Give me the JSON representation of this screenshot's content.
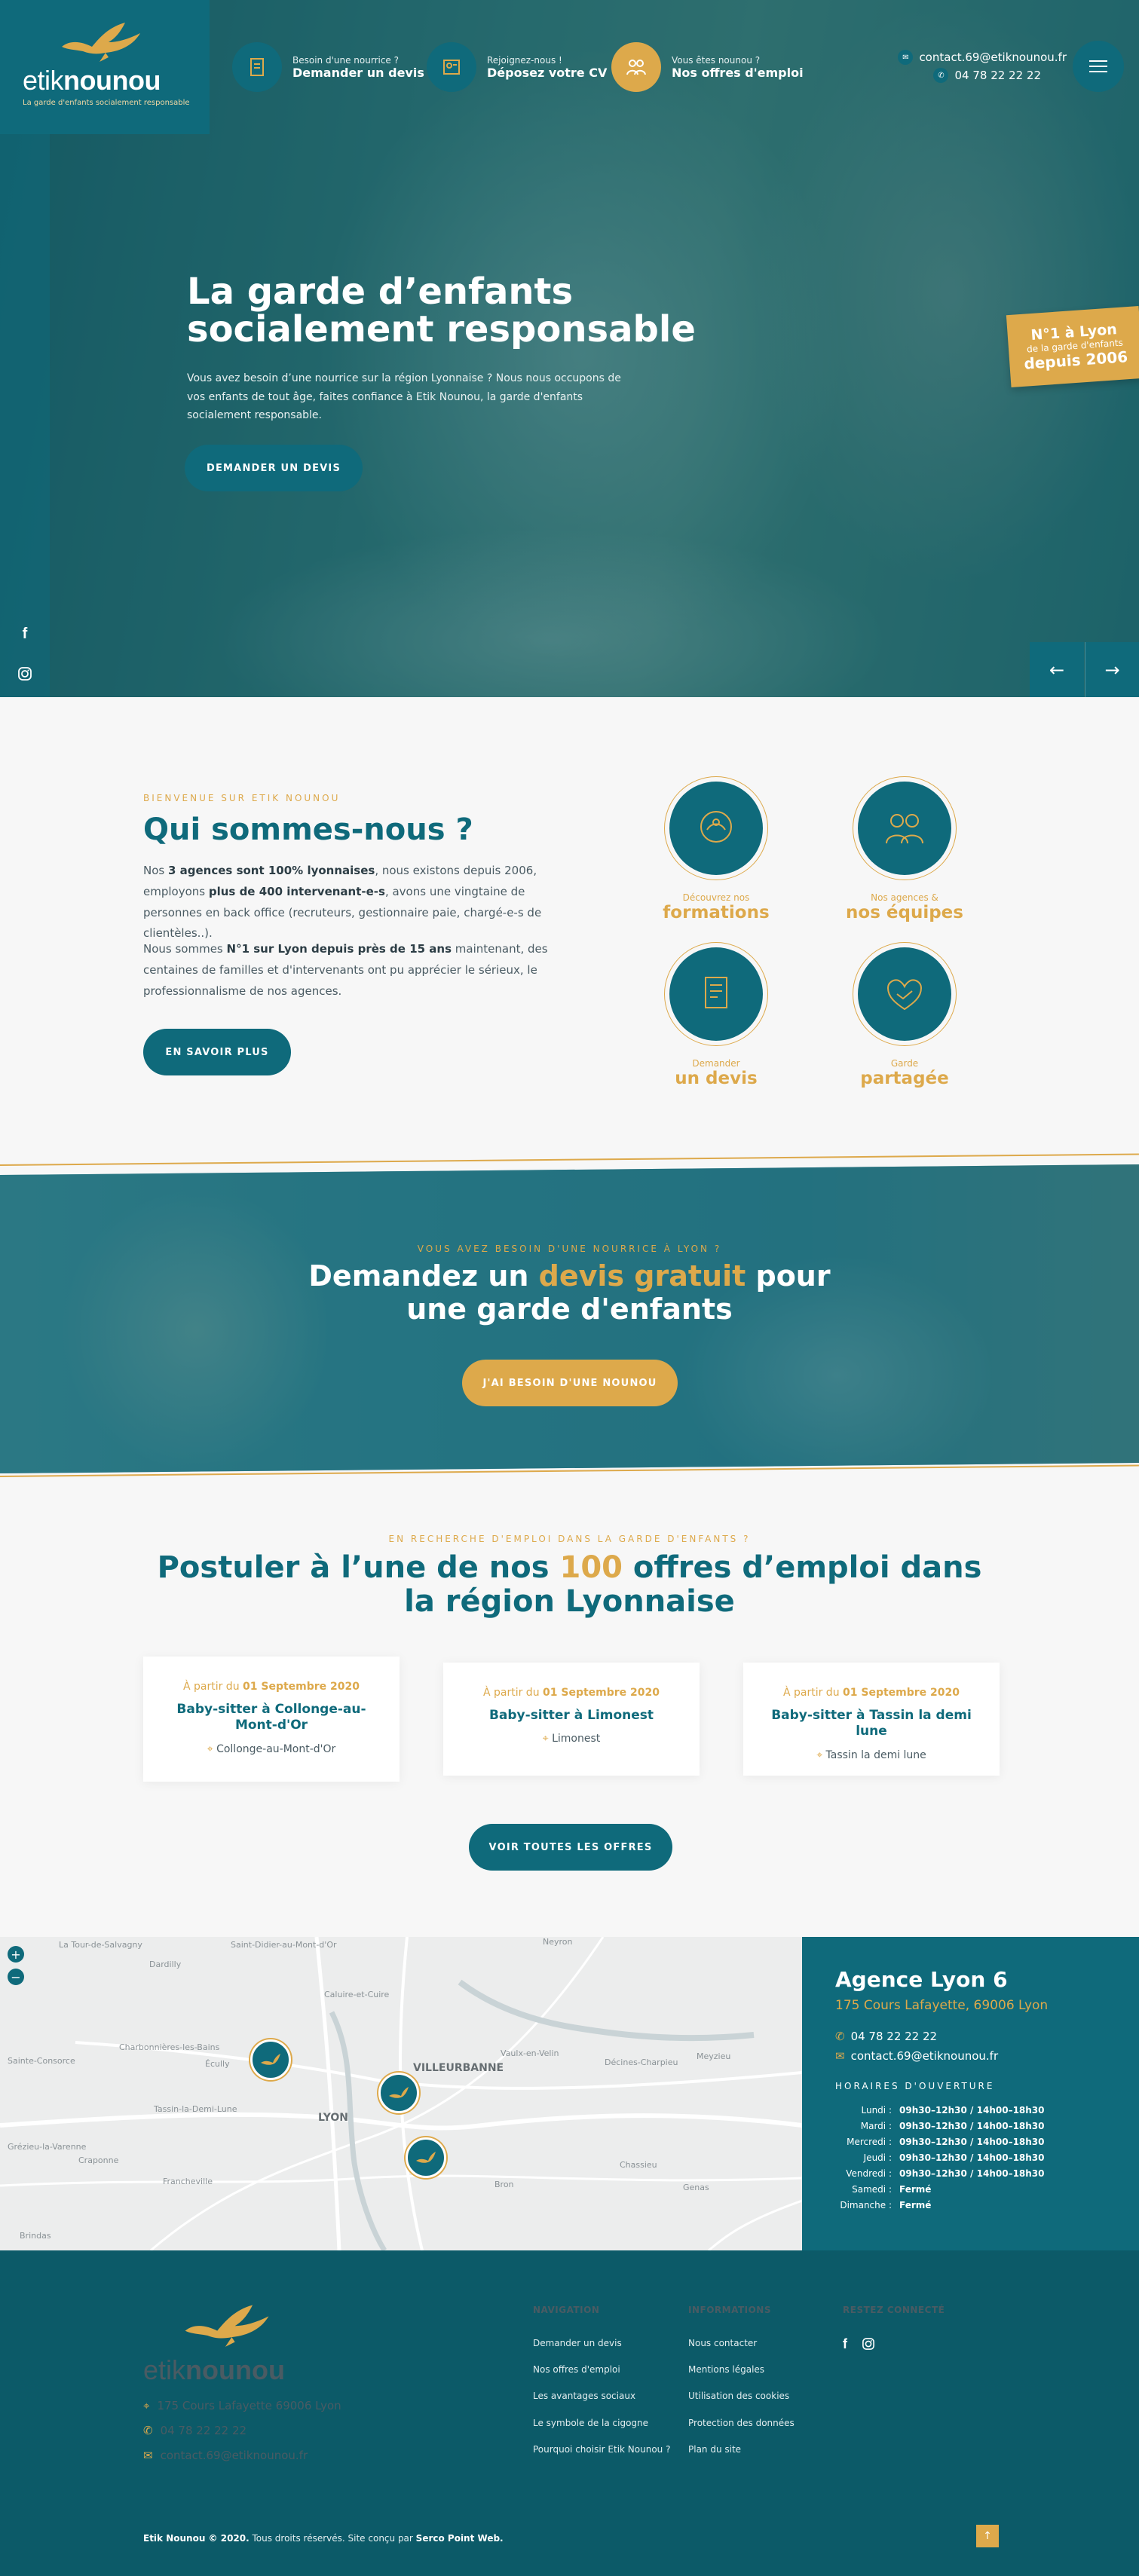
{
  "brand": {
    "name_light": "etik",
    "name_bold": "nounou",
    "tagline": "La garde d'enfants socialement responsable"
  },
  "topnav": [
    {
      "small": "Besoin d'une nourrice ?",
      "big": "Demander un devis",
      "icon": "document-icon"
    },
    {
      "small": "Rejoignez-nous !",
      "big": "Déposez votre CV",
      "icon": "cv-icon"
    },
    {
      "small": "Vous êtes nounou ?",
      "big": "Nos offres d'emploi",
      "icon": "people-icon"
    }
  ],
  "contact": {
    "email": "contact.69@etiknounou.fr",
    "phone": "04 78 22 22 22"
  },
  "hero": {
    "title_line1": "La garde d’enfants",
    "title_line2": "socialement responsable",
    "text": "Vous avez besoin d’une nourrice sur la région Lyonnaise ? Nous nous occupons de vos enfants de tout âge, faites confiance à Etik Nounou, la garde d'enfants socialement responsable.",
    "cta": "DEMANDER UN DEVIS",
    "badge_line1": "N°1 à Lyon",
    "badge_line2": "de la garde d'enfants",
    "badge_line3": "depuis 2006",
    "prev": "←",
    "next": "→"
  },
  "about": {
    "kicker": "BIENVENUE SUR ETIK NOUNOU",
    "title": "Qui sommes-nous ?",
    "p1_a": "Nos ",
    "p1_b": "3 agences sont 100% lyonnaises",
    "p1_c": ", nous existons depuis 2006, employons ",
    "p1_d": "plus de 400 intervenant-e-s",
    "p1_e": ", avons une vingtaine de personnes en back office (recruteurs, gestionnaire paie, chargé-e-s de clientèles..).",
    "p2_a": "Nous sommes ",
    "p2_b": "N°1 sur Lyon depuis près de 15 ans",
    "p2_c": " maintenant, des centaines de familles et d'intervenants ont pu apprécier le sérieux, le professionnalisme de nos agences.",
    "cta": "EN SAVOIR PLUS",
    "features": [
      {
        "small": "Découvrez nos",
        "big": "formations",
        "icon": "training-icon"
      },
      {
        "small": "Nos agences &",
        "big": "nos équipes",
        "icon": "team-icon"
      },
      {
        "small": "Demander",
        "big": "un devis",
        "icon": "document-icon"
      },
      {
        "small": "Garde",
        "big": "partagée",
        "icon": "handshake-icon"
      }
    ]
  },
  "devis": {
    "kicker": "VOUS AVEZ BESOIN D'UNE NOURRICE À LYON ?",
    "title_a": "Demandez un ",
    "title_b": "devis gratuit",
    "title_c": " pour",
    "title_line2": "une garde d'enfants",
    "cta": "J'AI BESOIN D'UNE NOUNOU"
  },
  "jobs": {
    "kicker": "EN RECHERCHE D'EMPLOI DANS LA GARDE D'ENFANTS ?",
    "title_a": "Postuler à l’une de nos ",
    "title_num": "100",
    "title_b": " offres d’emploi dans",
    "title_line2": "la région Lyonnaise",
    "cards": [
      {
        "date_prefix": "À partir du ",
        "date": "01 Septembre 2020",
        "title": "Baby-sitter à Collonge-au-Mont-d'Or",
        "location": "Collonge-au-Mont-d'Or"
      },
      {
        "date_prefix": "À partir du ",
        "date": "01 Septembre 2020",
        "title": "Baby-sitter à Limonest",
        "location": "Limonest"
      },
      {
        "date_prefix": "À partir du ",
        "date": "01 Septembre 2020",
        "title": "Baby-sitter à Tassin la demi lune",
        "location": "Tassin la demi lune"
      }
    ],
    "cta": "VOIR TOUTES LES OFFRES"
  },
  "map": {
    "zoom_in": "+",
    "zoom_out": "−",
    "labels": [
      "La Tour-de-Salvagny",
      "Saint-Didier-au-Mont-d'Or",
      "Dardilly",
      "Caluire-et-Cuire",
      "Charbonnières-les-Bains",
      "Écully",
      "VILLEURBANNE",
      "Vaulx-en-Velin",
      "Décines-Charpieu",
      "Meyzieu",
      "Sainte-Consorce",
      "Tassin-la-Demi-Lune",
      "LYON",
      "Craponne",
      "Francheville",
      "Chassieu",
      "Bron",
      "Genas",
      "Brindas",
      "Grézieu-la-Varenne",
      "Neyron"
    ]
  },
  "agency": {
    "title": "Agence Lyon 6",
    "address": "175 Cours Lafayette, 69006 Lyon",
    "phone": "04 78 22 22 22",
    "email": "contact.69@etiknounou.fr",
    "hours_title": "HORAIRES D'OUVERTURE",
    "hours": [
      {
        "day": "Lundi :",
        "hours": "09h30–12h30 / 14h00–18h30"
      },
      {
        "day": "Mardi :",
        "hours": "09h30–12h30 / 14h00–18h30"
      },
      {
        "day": "Mercredi :",
        "hours": "09h30–12h30 / 14h00–18h30"
      },
      {
        "day": "Jeudi :",
        "hours": "09h30–12h30 / 14h00–18h30"
      },
      {
        "day": "Vendredi :",
        "hours": "09h30–12h30 / 14h00–18h30"
      },
      {
        "day": "Samedi :",
        "hours": "Fermé"
      },
      {
        "day": "Dimanche :",
        "hours": "Fermé"
      }
    ]
  },
  "footer": {
    "address": "175 Cours Lafayette 69006 Lyon",
    "phone": "04 78 22 22 22",
    "email": "contact.69@etiknounou.fr",
    "nav_title": "NAVIGATION",
    "nav": [
      "Demander un devis",
      "Nos offres d'emploi",
      "Les avantages sociaux",
      "Le symbole de la cigogne",
      "Pourquoi choisir Etik Nounou ?"
    ],
    "info_title": "INFORMATIONS",
    "info": [
      "Nous contacter",
      "Mentions légales",
      "Utilisation des cookies",
      "Protection des données",
      "Plan du site"
    ],
    "social_title": "RESTEZ CONNECTÉ",
    "copy_brand": "Etik Nounou © 2020.",
    "copy_text": " Tous droits réservés. Site conçu par ",
    "copy_agency": "Serco Point Web.",
    "to_top": "↑"
  },
  "colors": {
    "teal": "#0f6a7b",
    "gold": "#dda94b",
    "footer": "#0c5a68"
  }
}
